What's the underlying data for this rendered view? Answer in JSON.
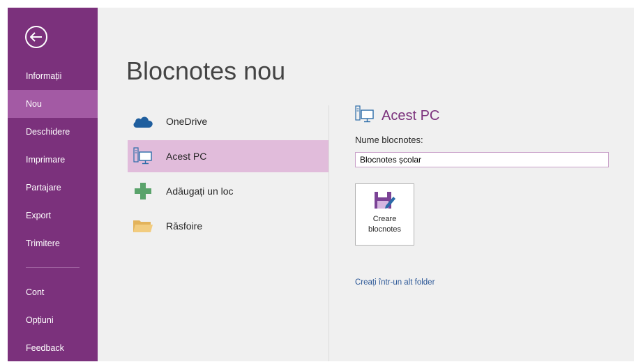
{
  "sidebar": {
    "items": [
      {
        "label": "Informații"
      },
      {
        "label": "Nou",
        "active": true
      },
      {
        "label": "Deschidere"
      },
      {
        "label": "Imprimare"
      },
      {
        "label": "Partajare"
      },
      {
        "label": "Export"
      },
      {
        "label": "Trimitere"
      }
    ],
    "bottom_items": [
      {
        "label": "Cont"
      },
      {
        "label": "Opțiuni"
      },
      {
        "label": "Feedback"
      }
    ]
  },
  "main": {
    "title": "Blocnotes nou",
    "locations": [
      {
        "label": "OneDrive",
        "icon": "cloud-icon"
      },
      {
        "label": "Acest PC",
        "icon": "computer-icon",
        "selected": true
      },
      {
        "label": "Adăugați un loc",
        "icon": "plus-icon"
      },
      {
        "label": "Răsfoire",
        "icon": "folder-icon"
      }
    ]
  },
  "detail": {
    "title": "Acest PC",
    "name_label": "Nume blocnotes:",
    "name_value": "Blocnotes școlar",
    "create_label": "Creare\nblocnotes",
    "alt_folder_link": "Creați într-un alt folder"
  },
  "colors": {
    "accent": "#7b317c",
    "nav_active": "#a35aa4",
    "location_selected": "#e1bcdb",
    "content_bg": "#f0f0f0",
    "link": "#2b5797"
  }
}
